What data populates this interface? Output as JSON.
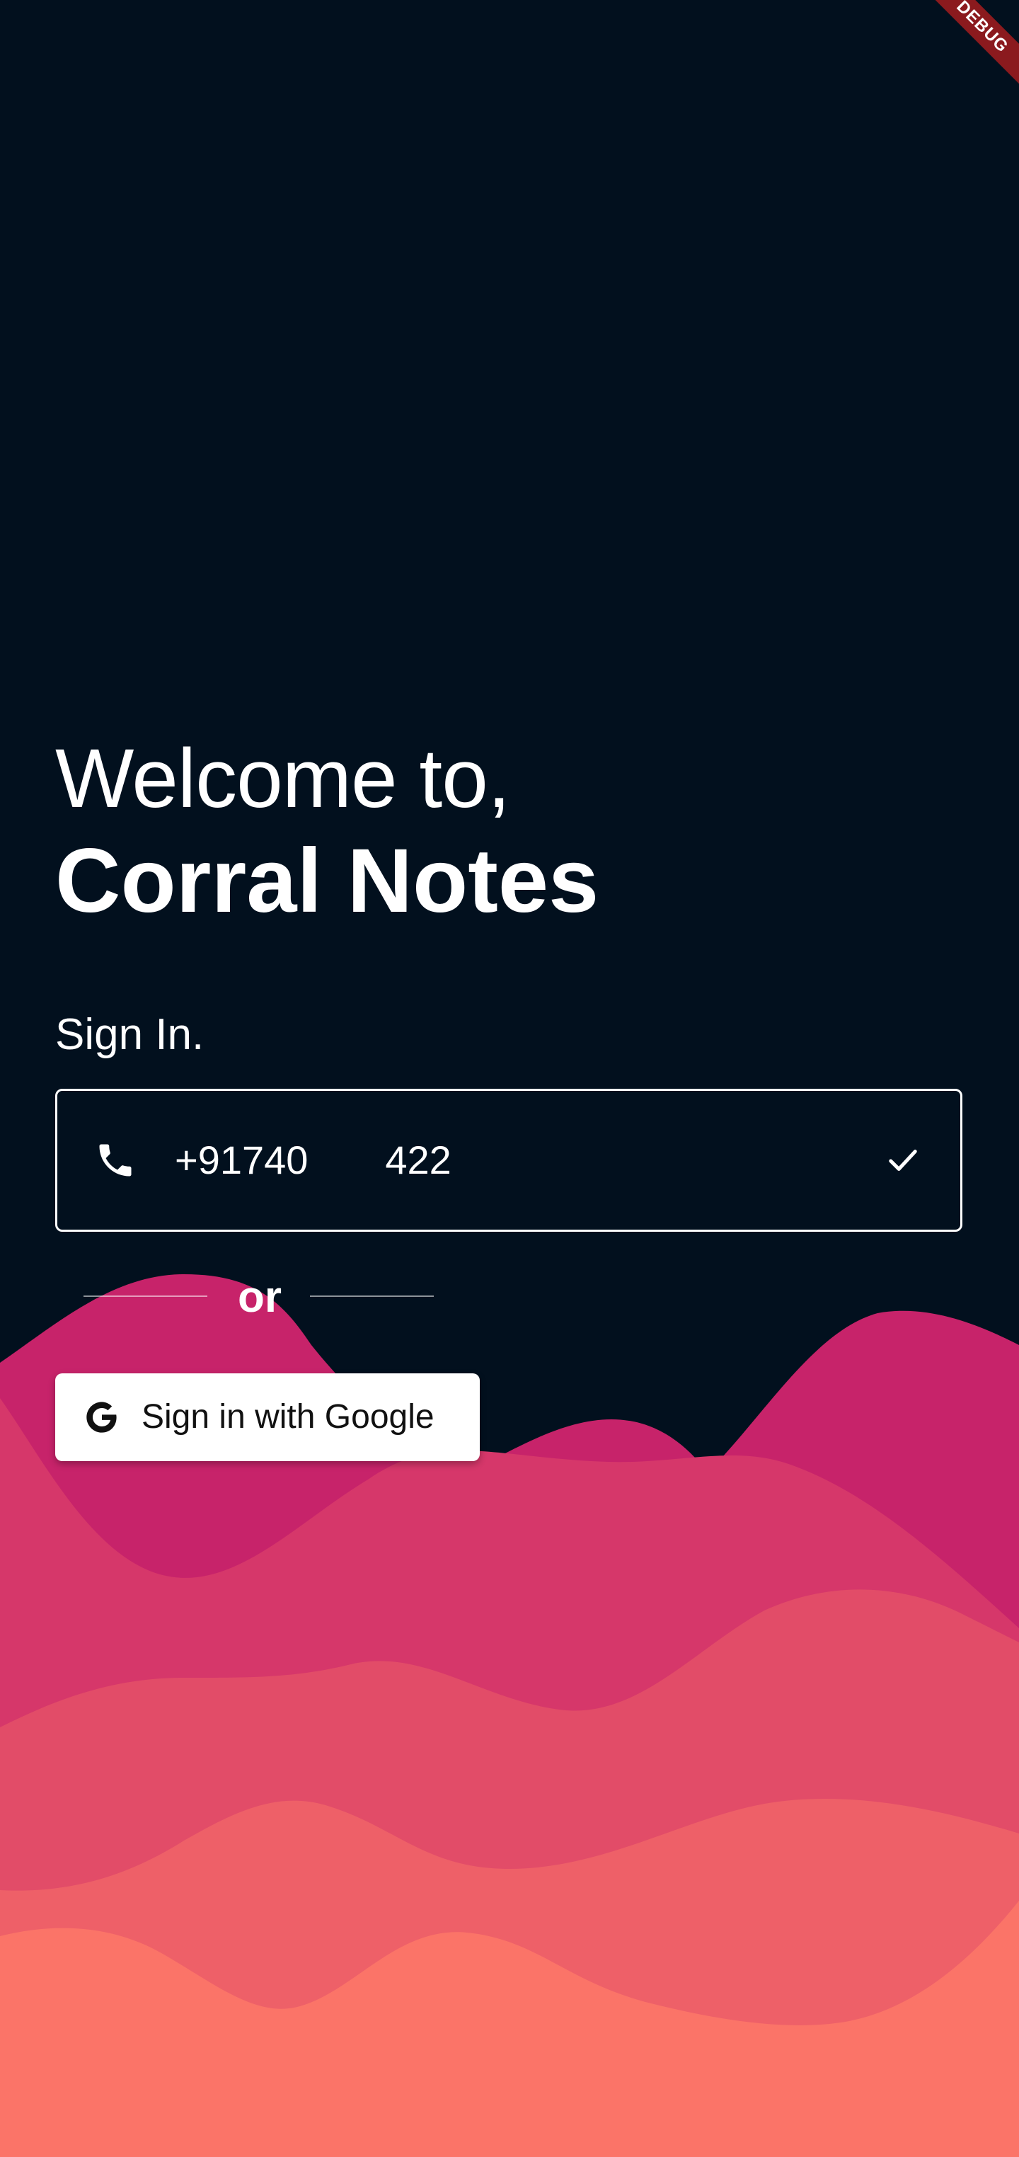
{
  "debug_banner": {
    "label": "DEBUG"
  },
  "welcome": {
    "greeting": "Welcome to,",
    "app_name": "Corral Notes"
  },
  "signin": {
    "heading": "Sign In.",
    "phone_field": {
      "value": "+91740       422",
      "leading_icon": "phone-icon",
      "trailing_icon": "check-icon"
    },
    "divider_text": "or",
    "google_button": {
      "label": "Sign in with Google",
      "icon": "google-g-icon"
    }
  },
  "colors": {
    "background": "#02101e",
    "wave_magenta": "#c7236a",
    "wave_rose": "#d6376a",
    "wave_pink": "#e24c68",
    "wave_coral": "#ee6068",
    "wave_salmon": "#fb7468"
  }
}
